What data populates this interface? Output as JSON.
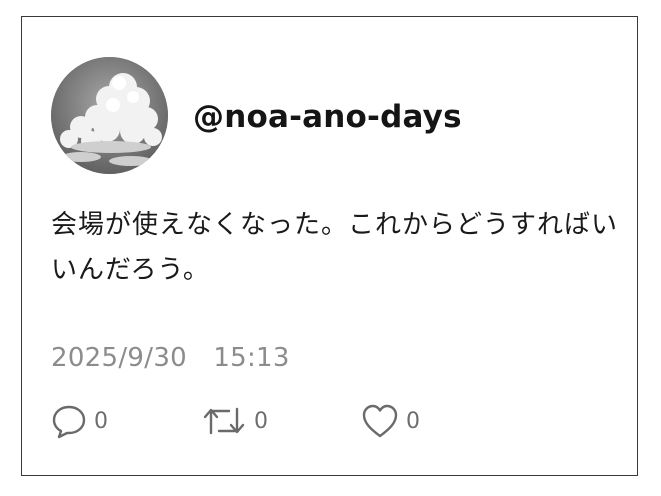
{
  "post": {
    "handle": "@noa-ano-days",
    "text": "会場が使えなくなった。これからどうすればいいんだろう。",
    "timestamp": "2025/9/30　15:13",
    "avatar_icon": "cloud-avatar-icon",
    "actions": {
      "reply": {
        "icon": "reply-icon",
        "count": "0"
      },
      "retweet": {
        "icon": "retweet-icon",
        "count": "0"
      },
      "like": {
        "icon": "heart-icon",
        "count": "0"
      }
    }
  }
}
